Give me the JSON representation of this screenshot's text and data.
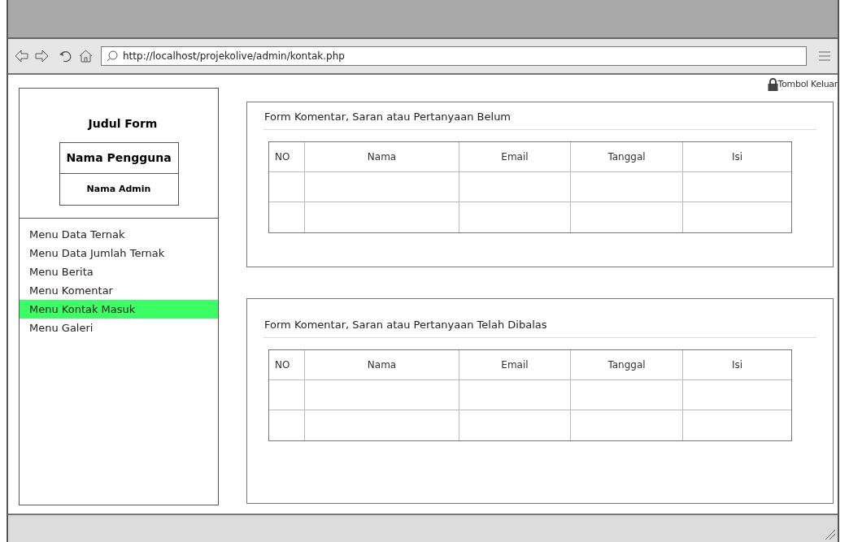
{
  "browser": {
    "url": "http://localhost/projekolive/admin/kontak.php"
  },
  "logout": {
    "label": "Tombol Keluar"
  },
  "sidebar": {
    "title": "Judul Form",
    "user_header": "Nama Pengguna",
    "user_name": "Nama Admin",
    "menu": [
      {
        "label": "Menu Data Ternak",
        "selected": false
      },
      {
        "label": "Menu Data Jumlah Ternak",
        "selected": false
      },
      {
        "label": "Menu Berita",
        "selected": false
      },
      {
        "label": "Menu Komentar",
        "selected": false
      },
      {
        "label": "Menu Kontak Masuk",
        "selected": true
      },
      {
        "label": "Menu Galeri",
        "selected": false
      }
    ]
  },
  "panels": [
    {
      "title": "Form Komentar, Saran atau Pertanyaan Belum",
      "columns": [
        "NO",
        "Nama",
        "Email",
        "Tanggal",
        "Isi"
      ]
    },
    {
      "title": "Form Komentar, Saran atau Pertanyaan Telah Dibalas",
      "columns": [
        "NO",
        "Nama",
        "Email",
        "Tanggal",
        "Isi"
      ]
    }
  ]
}
